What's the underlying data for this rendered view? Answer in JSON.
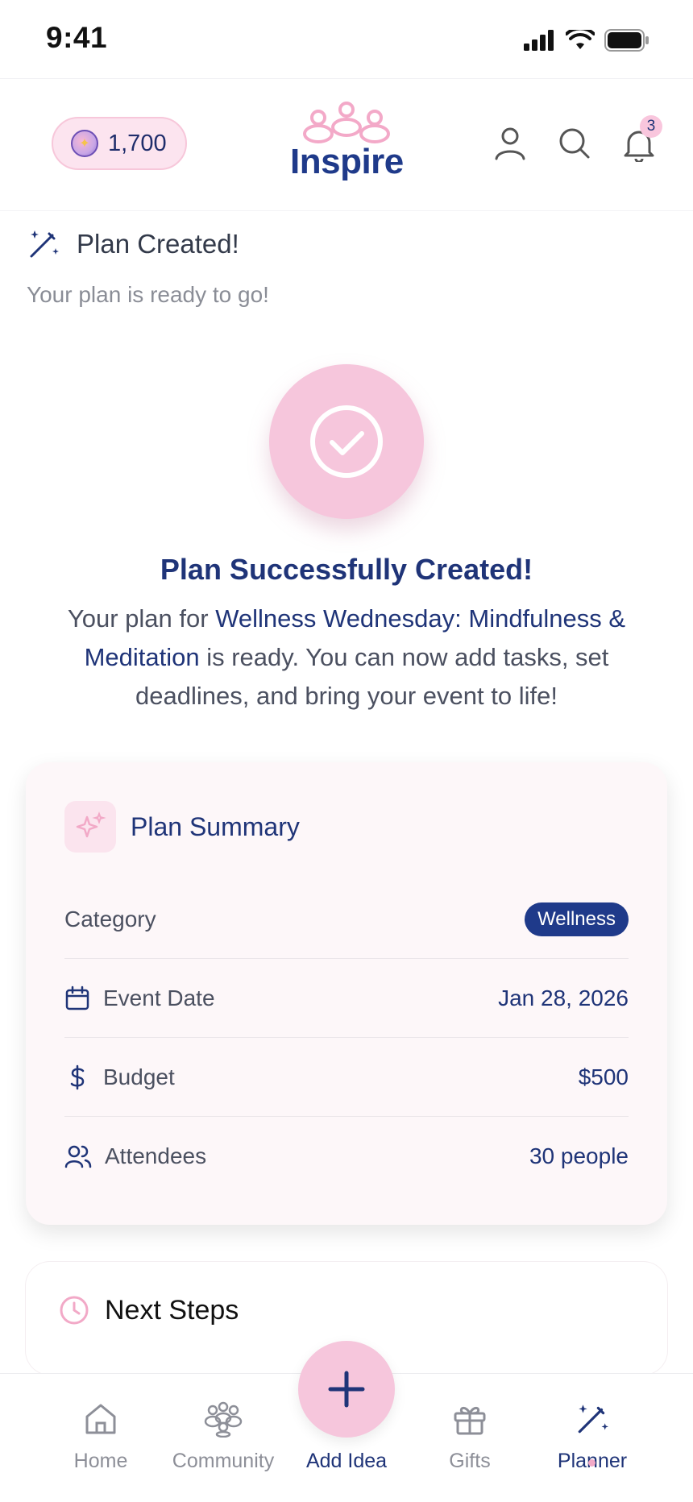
{
  "status_bar": {
    "time": "9:41"
  },
  "header": {
    "points": "1,700",
    "logo_text": "Inspire",
    "notification_count": "3"
  },
  "section": {
    "title": "Plan Created!",
    "subtitle": "Your plan is ready to go!"
  },
  "success": {
    "title": "Plan Successfully Created!",
    "body_prefix": "Your plan for ",
    "plan_name": "Wellness Wednesday: Mindfulness & Meditation",
    "body_suffix": " is ready. You can now add tasks, set deadlines, and bring your event to life!"
  },
  "summary": {
    "title": "Plan Summary",
    "rows": [
      {
        "label": "Category",
        "value": "Wellness"
      },
      {
        "label": "Event Date",
        "value": "Jan 28, 2026"
      },
      {
        "label": "Budget",
        "value": "$500"
      },
      {
        "label": "Attendees",
        "value": "30 people"
      }
    ]
  },
  "next_steps": {
    "title": "Next Steps"
  },
  "nav": {
    "items": [
      {
        "label": "Home",
        "icon": "home-icon"
      },
      {
        "label": "Community",
        "icon": "community-icon"
      },
      {
        "label": "Add Idea",
        "icon": "plus-icon"
      },
      {
        "label": "Gifts",
        "icon": "gift-icon"
      },
      {
        "label": "Planner",
        "icon": "magic-wand-icon",
        "active": true
      }
    ]
  },
  "colors": {
    "primary": "#1f3478",
    "accent_pink": "#f6c6dc",
    "muted_text": "#8a8d96"
  }
}
